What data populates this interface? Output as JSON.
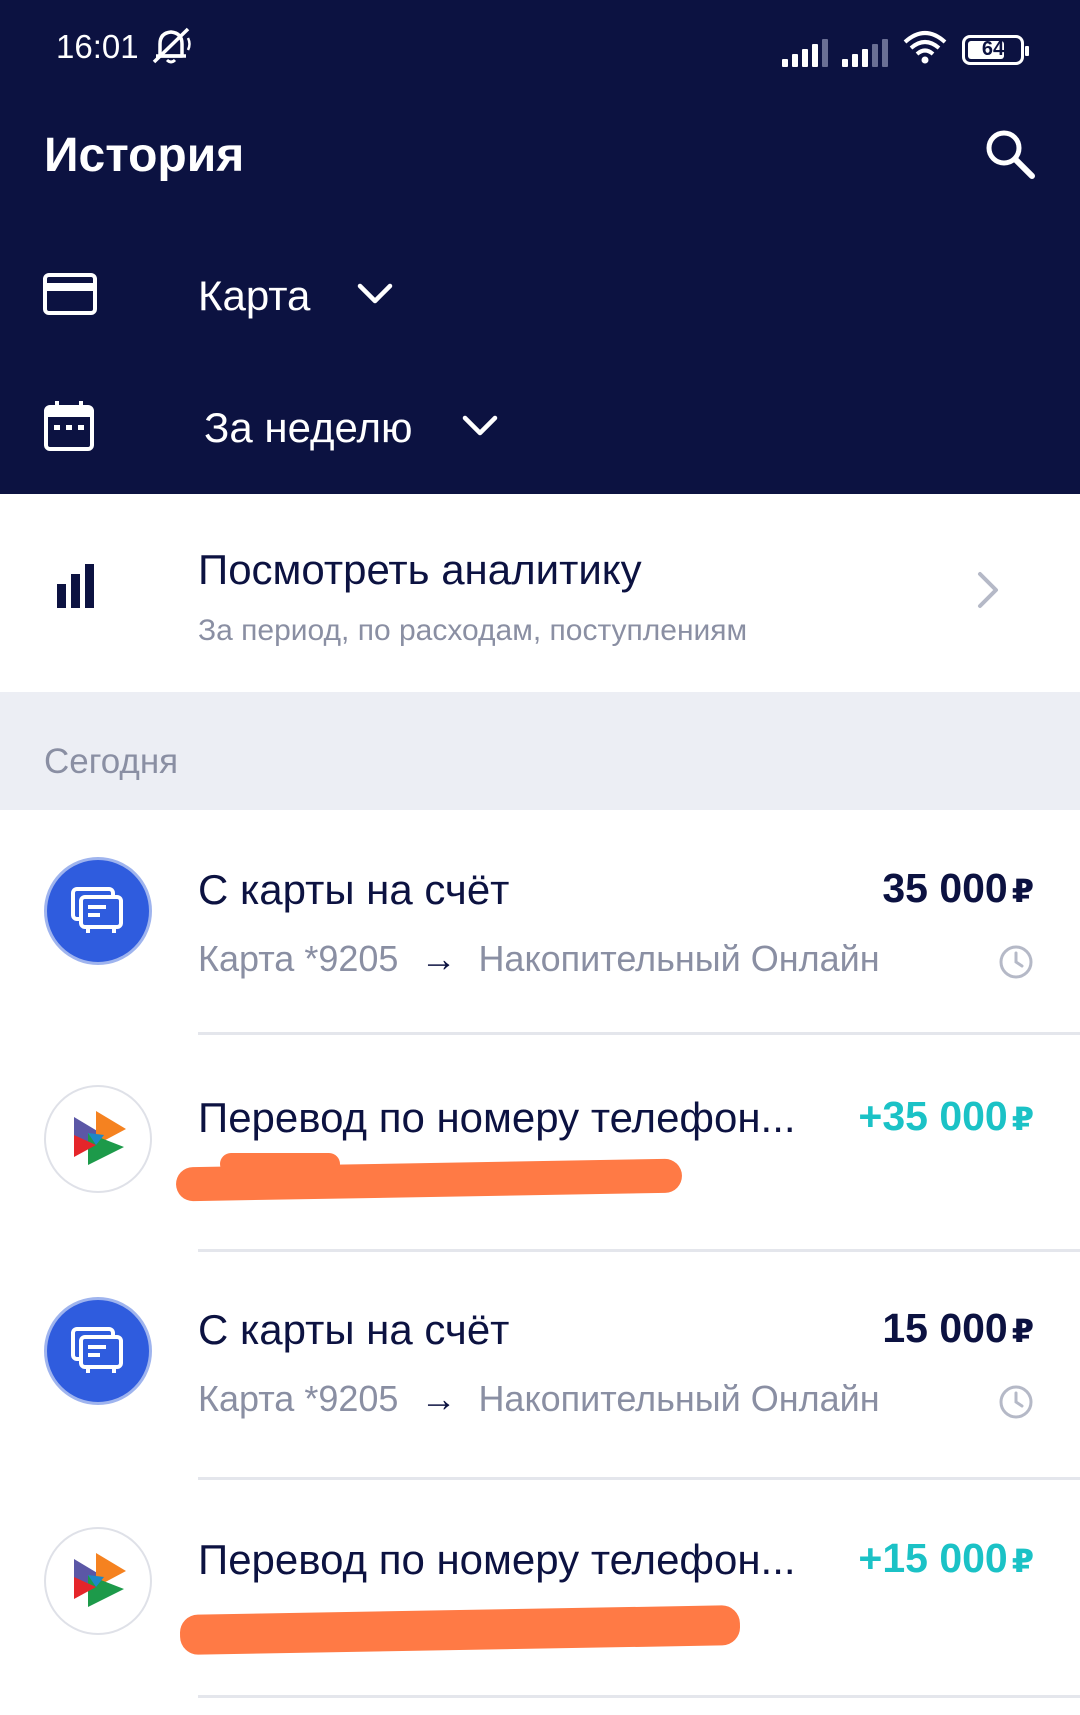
{
  "status_bar": {
    "time": "16:01",
    "battery": "64",
    "icons": [
      "mute-icon",
      "signal-icon",
      "signal-icon",
      "wifi-icon",
      "battery-icon"
    ]
  },
  "header": {
    "title": "История",
    "search_icon": "search-icon"
  },
  "filters": {
    "card_label": "Карта",
    "period_label": "За неделю"
  },
  "analytics": {
    "title": "Посмотреть аналитику",
    "subtitle": "За период, по расходам, поступлениям"
  },
  "section": {
    "label": "Сегодня"
  },
  "transactions": [
    {
      "title": "С карты на счёт",
      "amount": "35 000",
      "currency": "₽",
      "from": "Карта *9205",
      "arrow": "→",
      "to": "Накопительный Онлайн",
      "type": "transfer-own"
    },
    {
      "title": "Перевод по номеру телефон...",
      "amount": "+35 000",
      "currency": "₽",
      "type": "sbp-incoming"
    },
    {
      "title": "С карты на счёт",
      "amount": "15 000",
      "currency": "₽",
      "from": "Карта *9205",
      "arrow": "→",
      "to": "Накопительный Онлайн",
      "type": "transfer-own"
    },
    {
      "title": "Перевод по номеру телефон...",
      "amount": "+15 000",
      "currency": "₽",
      "type": "sbp-incoming"
    }
  ],
  "colors": {
    "header_bg": "#0c1241",
    "accent_blue": "#2f5cde",
    "income_green": "#1bc2c6",
    "muted_text": "#8a8fa3",
    "section_bg": "#eceef4",
    "redaction": "#ff7a45"
  }
}
